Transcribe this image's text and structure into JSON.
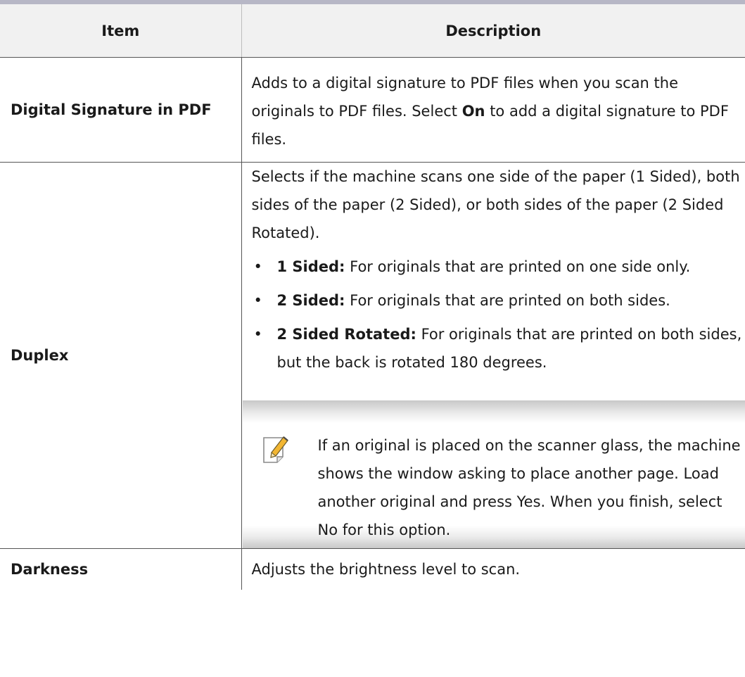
{
  "table": {
    "header": {
      "item": "Item",
      "description": "Description"
    },
    "rows": {
      "signature": {
        "item": "Digital Signature in PDF",
        "desc_before": "Adds to a digital signature to PDF files when you scan the originals to PDF files. Select ",
        "desc_bold": "On",
        "desc_after": " to add a digital signature to PDF files."
      },
      "duplex": {
        "item": "Duplex",
        "intro": "Selects if the machine scans one side of the paper (1 Sided), both sides of the paper (2 Sided), or both sides of the paper (2 Sided Rotated).",
        "bullets": [
          {
            "term": "1 Sided:",
            "text": " For originals that are printed on one side only."
          },
          {
            "term": "2 Sided:",
            "text": " For originals that are printed on both sides."
          },
          {
            "term": "2 Sided Rotated:",
            "text": " For originals that are printed on both sides, but the back is rotated 180 degrees."
          }
        ],
        "note": {
          "icon": "note-pencil-icon",
          "text": "If an original is placed on the scanner glass, the machine shows the window asking to place another page. Load another original and press Yes. When you finish, select No for this option."
        }
      },
      "darkness": {
        "item": "Darkness",
        "description": "Adjusts the brightness level to scan."
      }
    }
  },
  "colors": {
    "top_rule": "#b7b7c6",
    "header_bg": "#f1f1f1",
    "note_band": "#c8c8c8",
    "note_icon_pencil": "#f2b632"
  }
}
